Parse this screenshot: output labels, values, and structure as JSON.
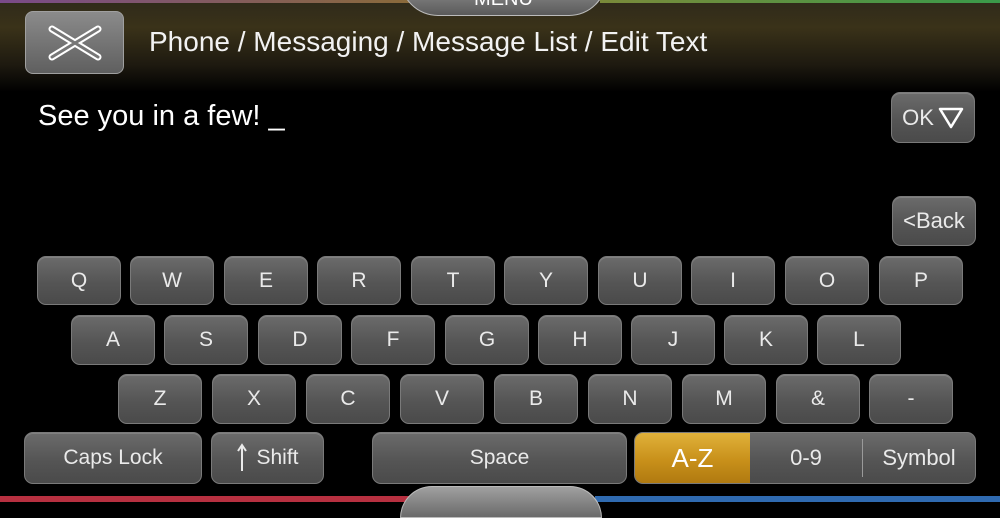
{
  "header": {
    "menu_label": "MENU",
    "breadcrumb": "Phone / Messaging / Message List / Edit Text"
  },
  "editor": {
    "text": "See you in a few! _"
  },
  "actions": {
    "ok_label": "OK",
    "back_label": "<Back"
  },
  "keyboard": {
    "row1": [
      "Q",
      "W",
      "E",
      "R",
      "T",
      "Y",
      "U",
      "I",
      "O",
      "P"
    ],
    "row2": [
      "A",
      "S",
      "D",
      "F",
      "G",
      "H",
      "J",
      "K",
      "L"
    ],
    "row3": [
      "Z",
      "X",
      "C",
      "V",
      "B",
      "N",
      "M",
      "&",
      "-"
    ],
    "caps_lock_label": "Caps Lock",
    "shift_label": "Shift",
    "space_label": "Space",
    "modes": [
      {
        "label": "A-Z",
        "active": true
      },
      {
        "label": "0-9",
        "active": false
      },
      {
        "label": "Symbol",
        "active": false
      }
    ]
  },
  "colors": {
    "accent": "#c8901a",
    "key_bg": "#555555"
  }
}
